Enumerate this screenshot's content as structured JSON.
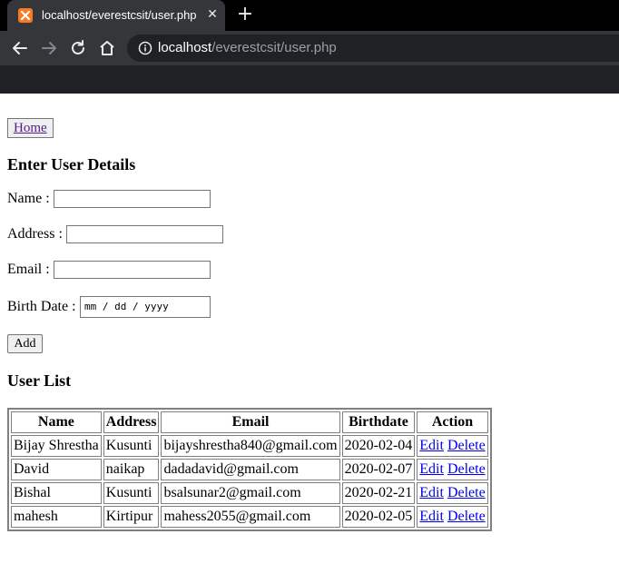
{
  "browser": {
    "tab_title": "localhost/everestcsit/user.php",
    "tab_close": "✕",
    "new_tab": "+",
    "url_host": "localhost",
    "url_path": "/everestcsit/user.php",
    "accent_color": "#fb7a24"
  },
  "page": {
    "home_link": "Home",
    "form_heading": "Enter User Details",
    "fields": {
      "name_label": "Name :",
      "address_label": "Address :",
      "email_label": "Email :",
      "birthdate_label": "Birth Date :",
      "birthdate_placeholder": "mm / dd / yyyy"
    },
    "add_button": "Add",
    "list_heading": "User List",
    "table": {
      "headers": [
        "Name",
        "Address",
        "Email",
        "Birthdate",
        "Action"
      ],
      "rows": [
        {
          "name": "Bijay Shrestha",
          "address": "Kusunti",
          "email": "bijayshrestha840@gmail.com",
          "birthdate": "2020-02-04",
          "edit": "Edit",
          "delete": "Delete"
        },
        {
          "name": "David",
          "address": "naikap",
          "email": "dadadavid@gmail.com",
          "birthdate": "2020-02-07",
          "edit": "Edit",
          "delete": "Delete"
        },
        {
          "name": "Bishal",
          "address": "Kusunti",
          "email": "bsalsunar2@gmail.com",
          "birthdate": "2020-02-21",
          "edit": "Edit",
          "delete": "Delete"
        },
        {
          "name": "mahesh",
          "address": "Kirtipur",
          "email": "mahess2055@gmail.com",
          "birthdate": "2020-02-05",
          "edit": "Edit",
          "delete": "Delete"
        }
      ]
    }
  }
}
